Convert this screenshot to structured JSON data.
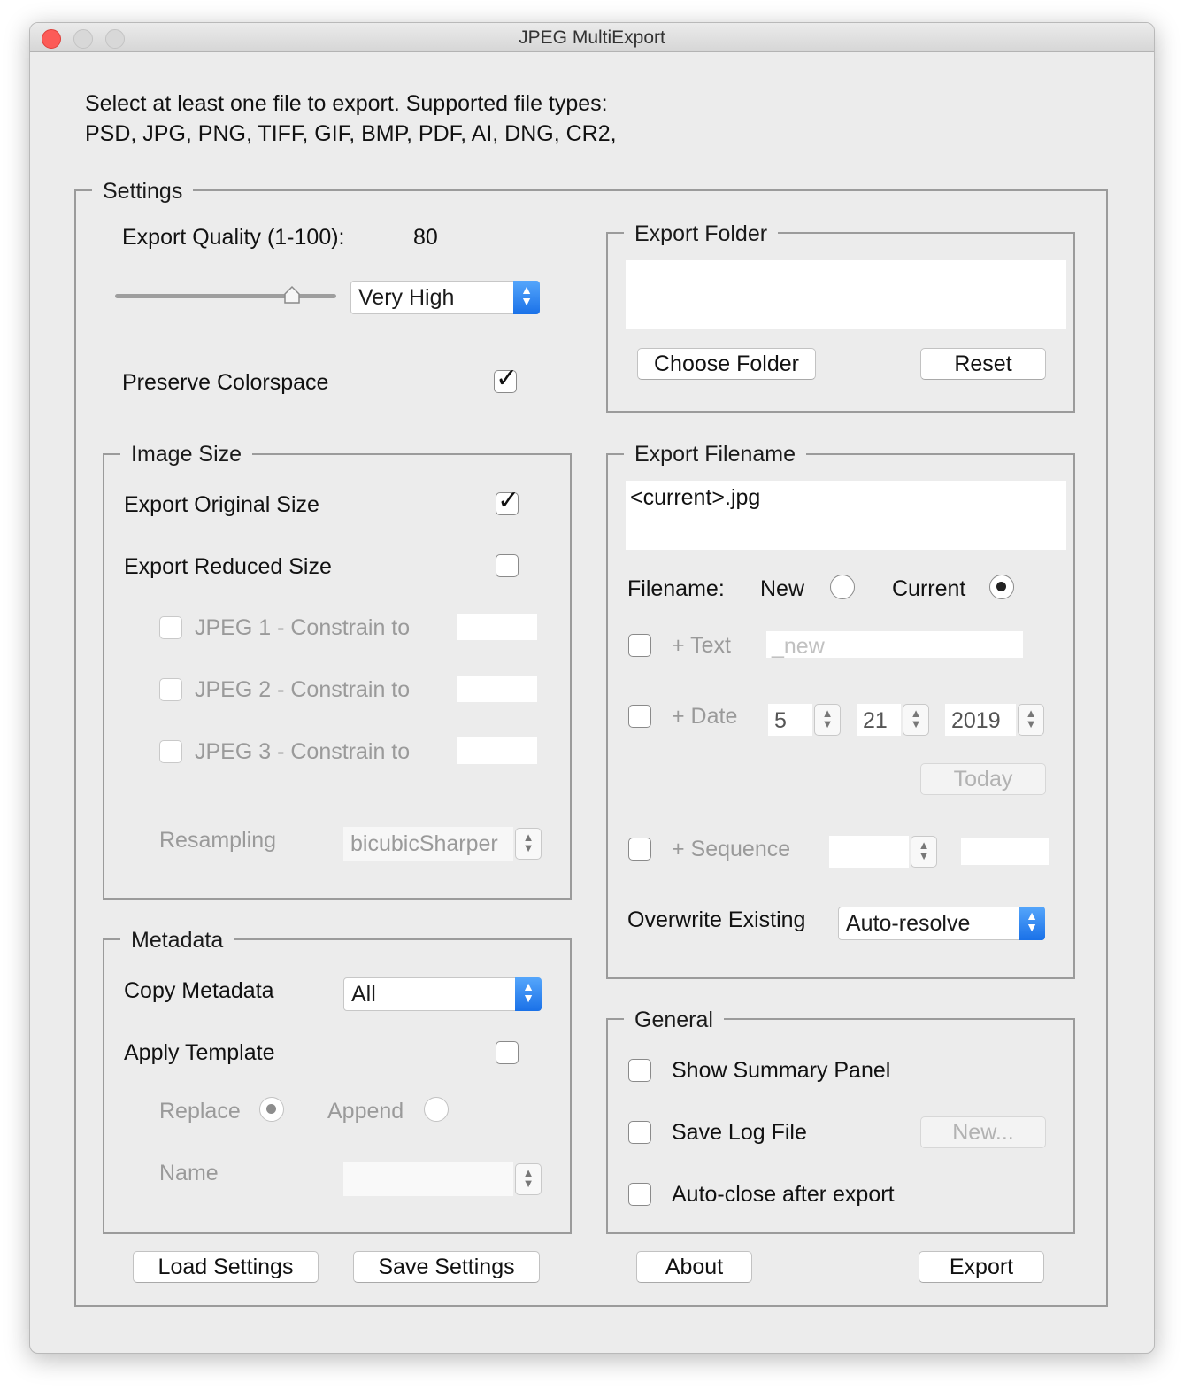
{
  "window": {
    "title": "JPEG MultiExport"
  },
  "intro": {
    "line1": "Select at least one file to export. Supported file types:",
    "line2": "PSD, JPG, PNG, TIFF, GIF, BMP, PDF, AI, DNG, CR2,"
  },
  "settings": {
    "legend": "Settings",
    "quality_label": "Export Quality (1-100):",
    "quality_value": "80",
    "quality_slider_fraction": 0.8,
    "quality_popup": "Very High",
    "preserve_colorspace_label": "Preserve Colorspace",
    "preserve_colorspace_checked": true
  },
  "image_size": {
    "legend": "Image Size",
    "export_original_label": "Export Original Size",
    "export_original_checked": true,
    "export_reduced_label": "Export Reduced Size",
    "export_reduced_checked": false,
    "jpeg1_label": "JPEG 1 - Constrain to",
    "jpeg2_label": "JPEG 2 - Constrain to",
    "jpeg3_label": "JPEG 3 - Constrain to",
    "resampling_label": "Resampling",
    "resampling_value": "bicubicSharper"
  },
  "metadata": {
    "legend": "Metadata",
    "copy_label": "Copy Metadata",
    "copy_value": "All",
    "apply_template_label": "Apply Template",
    "replace_label": "Replace",
    "append_label": "Append",
    "name_label": "Name"
  },
  "export_folder": {
    "legend": "Export Folder",
    "path": "",
    "choose_button": "Choose Folder",
    "reset_button": "Reset"
  },
  "export_filename": {
    "legend": "Export Filename",
    "preview": "<current>.jpg",
    "filename_label": "Filename:",
    "new_label": "New",
    "current_label": "Current",
    "text_label": "+ Text",
    "text_placeholder": "_new",
    "date_label": "+ Date",
    "date_month": "5",
    "date_day": "21",
    "date_year": "2019",
    "today_button": "Today",
    "sequence_label": "+ Sequence",
    "overwrite_label": "Overwrite Existing",
    "overwrite_value": "Auto-resolve"
  },
  "general": {
    "legend": "General",
    "summary_label": "Show Summary Panel",
    "log_label": "Save Log File",
    "log_button": "New...",
    "autoclose_label": "Auto-close after export"
  },
  "buttons": {
    "load": "Load Settings",
    "save": "Save Settings",
    "about": "About",
    "export": "Export"
  }
}
